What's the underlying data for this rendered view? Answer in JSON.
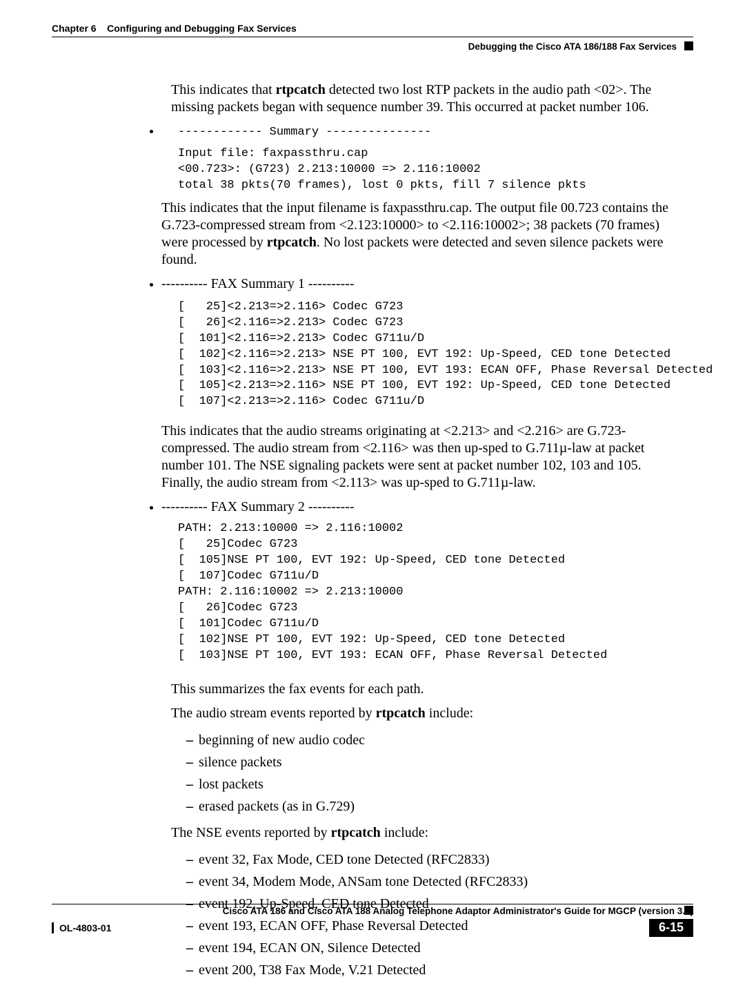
{
  "header": {
    "chapter_label": "Chapter 6",
    "chapter_title": "Configuring and Debugging Fax Services",
    "section_title": "Debugging the Cisco ATA 186/188 Fax Services"
  },
  "body": {
    "intro1_a": "This indicates that ",
    "intro1_b": "rtpcatch",
    "intro1_c": " detected two lost RTP packets in the audio path <02>.  The missing packets began with sequence number 39. This occurred at packet number 106.",
    "bullet_summary_title": "------------ Summary ---------------",
    "bullet_summary_code": "Input file: faxpassthru.cap\n<00.723>: (G723) 2.213:10000 => 2.116:10002\ntotal 38 pkts(70 frames), lost 0 pkts, fill 7 silence pkts",
    "summary_para_a": "This indicates that the input filename is faxpassthru.cap.  The output file 00.723 contains the G.723-compressed stream from <2.123:10000> to <2.116:10002>; 38 packets (70 frames) were processed by ",
    "summary_para_b": "rtpcatch",
    "summary_para_c": ". No lost packets were detected and seven silence packets were found.",
    "fax1_title": "---------- FAX Summary 1 ----------",
    "fax1_code": "[   25]<2.213=>2.116> Codec G723\n[   26]<2.116=>2.213> Codec G723\n[  101]<2.116=>2.213> Codec G711u/D\n[  102]<2.116=>2.213> NSE PT 100, EVT 192: Up-Speed, CED tone Detected\n[  103]<2.116=>2.213> NSE PT 100, EVT 193: ECAN OFF, Phase Reversal Detected\n[  105]<2.213=>2.116> NSE PT 100, EVT 192: Up-Speed, CED tone Detected\n[  107]<2.213=>2.116> Codec G711u/D",
    "fax1_para": "This indicates that the audio streams originating at <2.213> and <2.216> are G.723-compressed.  The audio stream from <2.116> was then up-sped to G.711µ-law at packet number 101.  The NSE signaling packets were sent at packet number 102, 103 and 105. Finally, the audio stream from <2.113> was up-sped to G.711µ-law.",
    "fax2_title": "---------- FAX Summary 2 ----------",
    "fax2_code": "PATH: 2.213:10000 => 2.116:10002\n[   25]Codec G723\n[  105]NSE PT 100, EVT 192: Up-Speed, CED tone Detected\n[  107]Codec G711u/D\nPATH: 2.116:10002 => 2.213:10000\n[   26]Codec G723\n[  101]Codec G711u/D\n[  102]NSE PT 100, EVT 192: Up-Speed, CED tone Detected\n[  103]NSE PT 100, EVT 193: ECAN OFF, Phase Reversal Detected",
    "summarize_line": "This summarizes the fax events for each path.",
    "audio_events_intro_a": "The audio stream events reported by ",
    "audio_events_intro_b": "rtpcatch",
    "audio_events_intro_c": " include:",
    "audio_events": [
      "beginning of new audio codec",
      "silence packets",
      "lost packets",
      "erased packets (as in G.729)"
    ],
    "nse_events_intro_a": "The NSE events reported by ",
    "nse_events_intro_b": "rtpcatch",
    "nse_events_intro_c": " include:",
    "nse_events": [
      "event 32, Fax Mode, CED tone Detected (RFC2833)",
      "event 34, Modem Mode, ANSam tone Detected (RFC2833)",
      "event 192, Up-Speed, CED tone Detected",
      "event 193, ECAN OFF, Phase Reversal Detected",
      "event 194, ECAN  ON, Silence Detected",
      "event 200, T38 Fax Mode, V.21 Detected"
    ]
  },
  "footer": {
    "book_title": "Cisco ATA 186 and Cisco ATA 188 Analog Telephone Adaptor Administrator's Guide for MGCP (version 3.0)",
    "doc_number": "OL-4803-01",
    "page_number": "6-15"
  }
}
